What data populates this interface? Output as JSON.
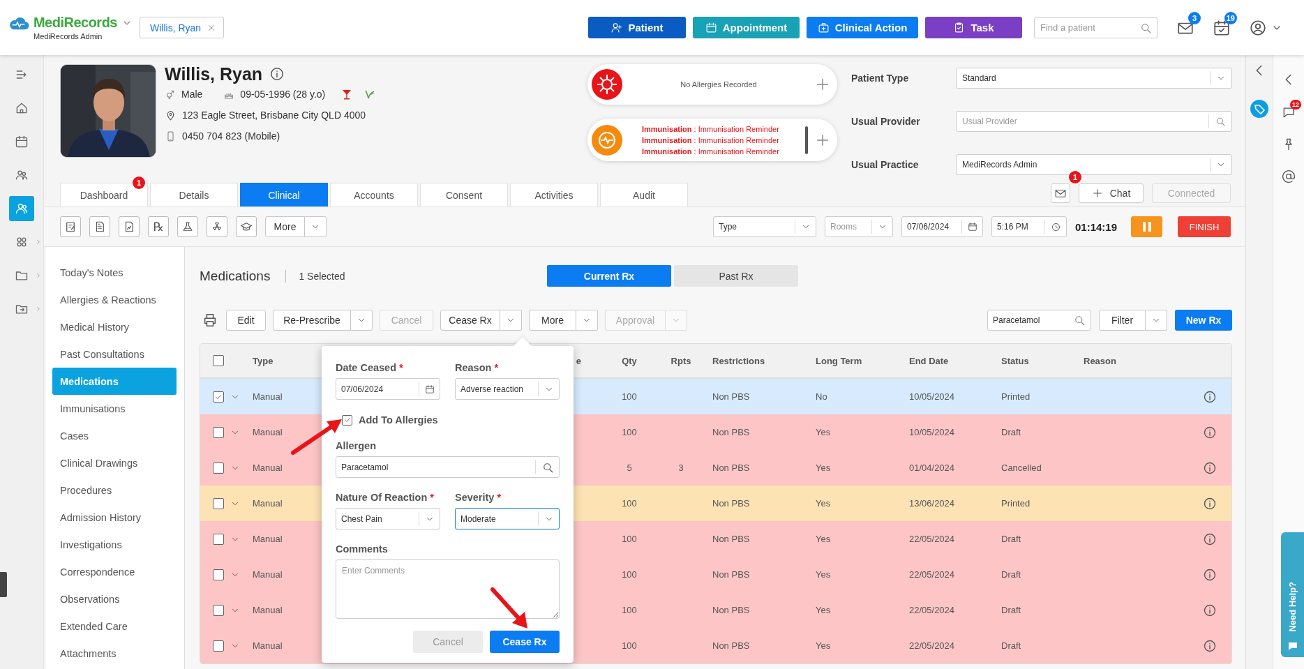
{
  "topbar": {
    "logo": "MediRecords",
    "practice": "MediRecords Admin",
    "patient_chip": "Willis, Ryan",
    "actions": [
      {
        "label": "Patient",
        "kind": "patient"
      },
      {
        "label": "Appointment",
        "kind": "appointment"
      },
      {
        "label": "Clinical Action",
        "kind": "clinical"
      },
      {
        "label": "Task",
        "kind": "task"
      }
    ],
    "search": {
      "placeholder": "Find a patient"
    },
    "messages_badge": "3",
    "tasks_badge": "19"
  },
  "rail": [
    {
      "kind": "collapse",
      "selected": false,
      "submenu": false
    },
    {
      "kind": "home",
      "selected": false,
      "submenu": false
    },
    {
      "kind": "calendar",
      "selected": false,
      "submenu": false
    },
    {
      "kind": "people",
      "selected": false,
      "submenu": false
    },
    {
      "kind": "person",
      "selected": true,
      "submenu": false
    },
    {
      "kind": "apps",
      "selected": false,
      "submenu": true
    },
    {
      "kind": "folder",
      "selected": false,
      "submenu": true
    },
    {
      "kind": "folder_move",
      "selected": false,
      "submenu": true
    }
  ],
  "patient": {
    "name": "Willis, Ryan",
    "gender": "Male",
    "dob": "09-05-1996 (28 y.o)",
    "address": "123 Eagle Street, Brisbane City QLD 4000",
    "phone": "0450 704 823 (Mobile)"
  },
  "alerts": {
    "allergies": "No Allergies Recorded",
    "immunisations": [
      "**Immunisation** : Immunisation Reminder",
      "**Immunisation** : Immunisation Reminder",
      "**Immunisation** : Immunisation Reminder"
    ]
  },
  "details": [
    {
      "label": "Patient Type",
      "kind": "select",
      "value": "Standard"
    },
    {
      "label": "Usual Provider",
      "kind": "search",
      "placeholder": "Usual Provider"
    },
    {
      "label": "Usual Practice",
      "kind": "select",
      "value": "MediRecords Admin"
    }
  ],
  "tabs": [
    {
      "label": "Dashboard",
      "selected": false,
      "badge": "1"
    },
    {
      "label": "Details",
      "selected": false
    },
    {
      "label": "Clinical",
      "selected": true
    },
    {
      "label": "Accounts",
      "selected": false
    },
    {
      "label": "Consent",
      "selected": false
    },
    {
      "label": "Activities",
      "selected": false
    },
    {
      "label": "Audit",
      "selected": false
    }
  ],
  "messaging": {
    "inbox_badge": "1",
    "chat": "Chat",
    "status": {
      "label": "Connected",
      "disabled": true
    }
  },
  "toolbar": {
    "rx_glyph": "℞",
    "more": "More",
    "type": {
      "value": "Type"
    },
    "rooms": {
      "placeholder": "Rooms"
    },
    "date": "07/06/2024",
    "time": "5:16 PM",
    "timer": "01:14:19",
    "finish": "FINISH"
  },
  "sidebar": {
    "items": [
      {
        "label": "Today's Notes",
        "selected": false
      },
      {
        "label": "Allergies & Reactions",
        "selected": false
      },
      {
        "label": "Medical History",
        "selected": false
      },
      {
        "label": "Past Consultations",
        "selected": false
      },
      {
        "label": "Medications",
        "selected": true
      },
      {
        "label": "Immunisations",
        "selected": false
      },
      {
        "label": "Cases",
        "selected": false
      },
      {
        "label": "Clinical Drawings",
        "selected": false
      },
      {
        "label": "Procedures",
        "selected": false
      },
      {
        "label": "Admission History",
        "selected": false
      },
      {
        "label": "Investigations",
        "selected": false
      },
      {
        "label": "Correspondence",
        "selected": false
      },
      {
        "label": "Observations",
        "selected": false
      },
      {
        "label": "Extended Care",
        "selected": false
      },
      {
        "label": "Attachments",
        "selected": false
      }
    ]
  },
  "medications": {
    "title": "Medications",
    "selection": "1 Selected",
    "views": [
      {
        "label": "Current Rx",
        "selected": true
      },
      {
        "label": "Past Rx",
        "selected": false
      }
    ],
    "actions": [
      {
        "label": "Edit",
        "kind": "button",
        "disabled": false
      },
      {
        "label": "Re-Prescribe",
        "kind": "split",
        "disabled": false
      },
      {
        "label": "Cancel",
        "kind": "button",
        "disabled": true
      },
      {
        "label": "Cease Rx",
        "kind": "split",
        "disabled": false
      },
      {
        "label": "More",
        "kind": "split",
        "disabled": false
      },
      {
        "label": "Approval",
        "kind": "split",
        "disabled": true
      }
    ],
    "search": {
      "value": "Paracetamol"
    },
    "filter": "Filter",
    "new_button": "New Rx"
  },
  "table": {
    "all_selected": false,
    "columns": [
      "Type",
      "e",
      "Qty",
      "Rpts",
      "Restrictions",
      "Long Term",
      "End Date",
      "Status",
      "Reason"
    ],
    "rows": [
      {
        "selected": true,
        "color": "#d7eafe",
        "type": "Manual",
        "qty": "100",
        "restrictions": "Non PBS",
        "long_term": "No",
        "end_date": "10/05/2024",
        "status": "Printed"
      },
      {
        "selected": false,
        "color": "#fdc5c6",
        "type": "Manual",
        "qty": "100",
        "restrictions": "Non PBS",
        "long_term": "Yes",
        "end_date": "10/05/2024",
        "status": "Draft"
      },
      {
        "selected": false,
        "color": "#fdc5c6",
        "type": "Manual",
        "qty": "5",
        "rpts": "3",
        "restrictions": "Non PBS",
        "long_term": "Yes",
        "end_date": "01/04/2024",
        "status": "Cancelled"
      },
      {
        "selected": false,
        "color": "#fde2b4",
        "type": "Manual",
        "qty": "100",
        "restrictions": "Non PBS",
        "long_term": "Yes",
        "end_date": "13/06/2024",
        "status": "Printed"
      },
      {
        "selected": false,
        "color": "#fdc5c6",
        "type": "Manual",
        "qty": "100",
        "restrictions": "Non PBS",
        "long_term": "Yes",
        "end_date": "22/05/2024",
        "status": "Draft"
      },
      {
        "selected": false,
        "color": "#fdc5c6",
        "type": "Manual",
        "qty": "100",
        "restrictions": "Non PBS",
        "long_term": "Yes",
        "end_date": "22/05/2024",
        "status": "Draft"
      },
      {
        "selected": false,
        "color": "#fdc5c6",
        "type": "Manual",
        "qty": "100",
        "restrictions": "Non PBS",
        "long_term": "Yes",
        "end_date": "22/05/2024",
        "status": "Draft"
      },
      {
        "selected": false,
        "color": "#fdc5c6",
        "type": "Manual",
        "qty": "100",
        "restrictions": "Non PBS",
        "long_term": "Yes",
        "end_date": "22/05/2024",
        "status": "Draft"
      }
    ]
  },
  "cease_popup": {
    "fields": [
      {
        "kind": "date",
        "label": "Date Ceased",
        "required_mark": "*",
        "value": "07/06/2024",
        "focused": false
      },
      {
        "kind": "select",
        "label": "Reason",
        "required_mark": "*",
        "value": "Adverse reaction",
        "focused": false
      },
      {
        "kind": "checkbox",
        "label": "Add To Allergies",
        "checked": true
      },
      {
        "kind": "search",
        "label": "Allergen",
        "value": "Paracetamol",
        "focused": false
      },
      {
        "kind": "select",
        "label": "Nature Of Reaction",
        "required_mark": "*",
        "value": "Chest Pain",
        "focused": false
      },
      {
        "kind": "select",
        "label": "Severity",
        "required_mark": "*",
        "value": "Moderate",
        "focused": true
      },
      {
        "kind": "textarea",
        "label": "Comments",
        "placeholder": "Enter Comments",
        "focused": false
      }
    ],
    "buttons": [
      {
        "label": "Cancel",
        "kind": "secondary"
      },
      {
        "label": "Cease Rx",
        "kind": "primary"
      }
    ]
  },
  "right_rail": {
    "chat_badge": "12",
    "help": "Need Help?"
  }
}
